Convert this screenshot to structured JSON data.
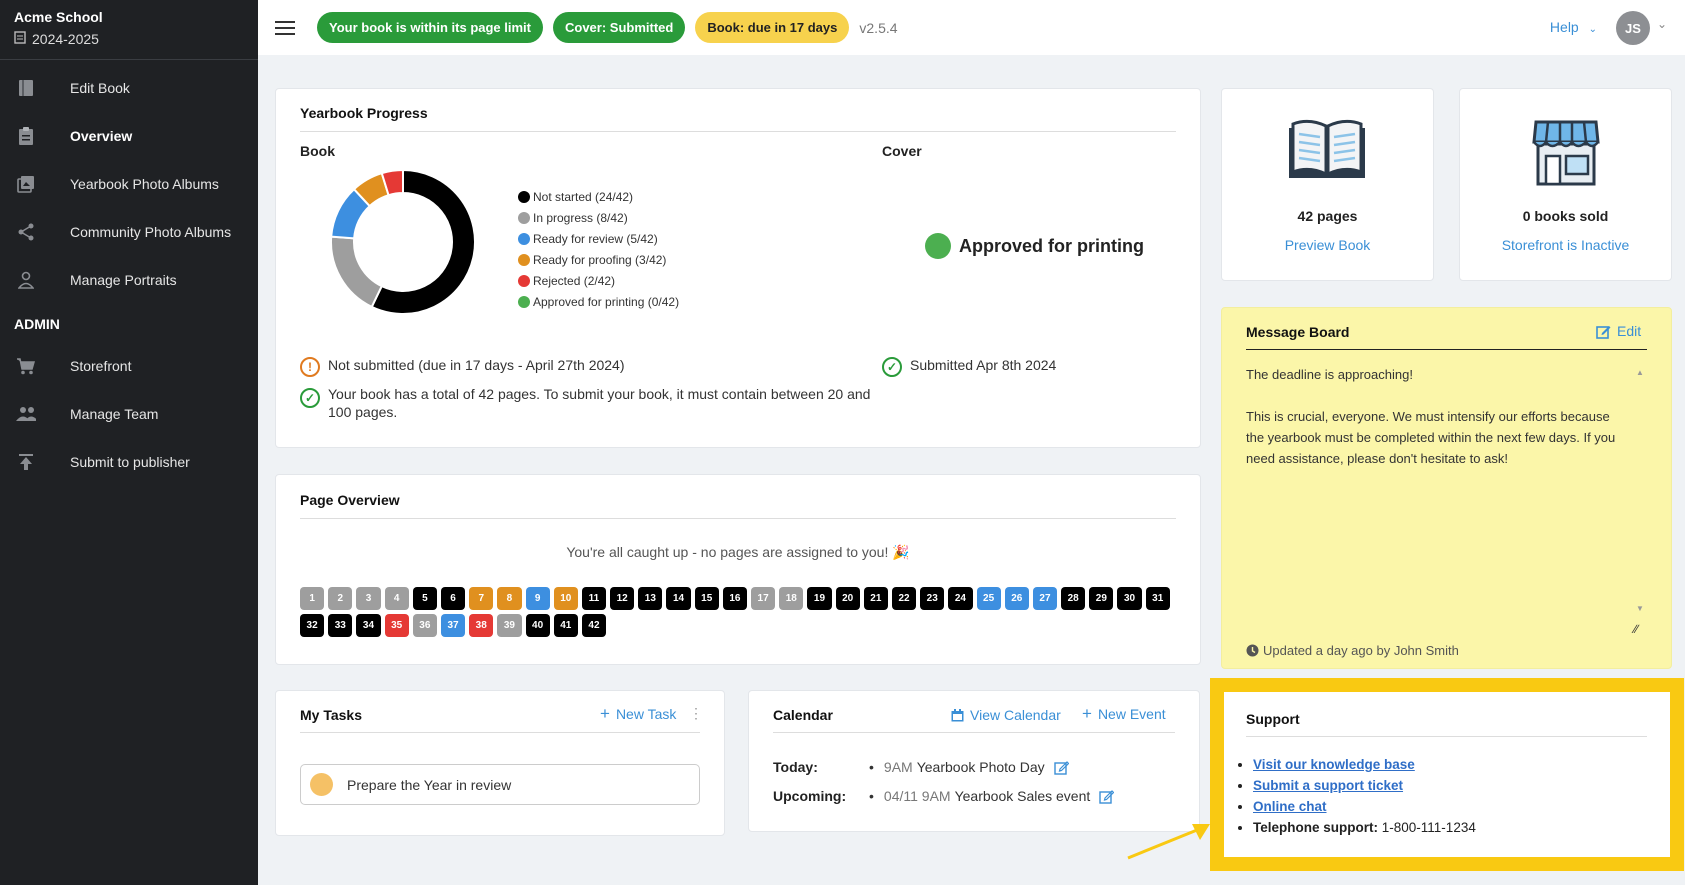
{
  "sidebar": {
    "school": "Acme School",
    "year": "2024-2025",
    "items": [
      {
        "label": "Edit Book"
      },
      {
        "label": "Overview"
      },
      {
        "label": "Yearbook Photo Albums"
      },
      {
        "label": "Community Photo Albums"
      },
      {
        "label": "Manage Portraits"
      }
    ],
    "admin_label": "ADMIN",
    "admin_items": [
      {
        "label": "Storefront"
      },
      {
        "label": "Manage Team"
      },
      {
        "label": "Submit to publisher"
      }
    ]
  },
  "topbar": {
    "badges": [
      {
        "label": "Your book is within its page limit",
        "color": "#2a9b3a"
      },
      {
        "label": "Cover: Submitted",
        "color": "#2a9b3a"
      },
      {
        "label": "Book: due in 17 days",
        "color": "#f7d24d"
      }
    ],
    "version": "v2.5.4",
    "help": "Help",
    "avatar": "JS"
  },
  "progress": {
    "title": "Yearbook Progress",
    "book_label": "Book",
    "cover_label": "Cover",
    "legend": [
      {
        "label": "Not started (24/42)",
        "color": "#000000",
        "value": 24
      },
      {
        "label": "In progress (8/42)",
        "color": "#9e9e9e",
        "value": 8
      },
      {
        "label": "Ready for review (5/42)",
        "color": "#3d8fe0",
        "value": 5
      },
      {
        "label": "Ready for proofing (3/42)",
        "color": "#e0901f",
        "value": 3
      },
      {
        "label": "Rejected (2/42)",
        "color": "#e53935",
        "value": 2
      },
      {
        "label": "Approved for printing (0/42)",
        "color": "#4caf50",
        "value": 0
      }
    ],
    "cover_status": "Approved for printing",
    "book_status": "Not submitted (due in 17 days - April 27th 2024)",
    "book_pages_note": "Your book has a total of 42 pages. To submit your book, it must contain between 20 and 100 pages.",
    "cover_submitted": "Submitted Apr 8th 2024"
  },
  "page_overview": {
    "title": "Page Overview",
    "message": "You're all caught up - no pages are assigned to you! 🎉",
    "pages": [
      {
        "n": "1",
        "c": "#9e9e9e"
      },
      {
        "n": "2",
        "c": "#9e9e9e"
      },
      {
        "n": "3",
        "c": "#9e9e9e"
      },
      {
        "n": "4",
        "c": "#9e9e9e"
      },
      {
        "n": "5",
        "c": "#000"
      },
      {
        "n": "6",
        "c": "#000"
      },
      {
        "n": "7",
        "c": "#e0901f"
      },
      {
        "n": "8",
        "c": "#e0901f"
      },
      {
        "n": "9",
        "c": "#3d8fe0"
      },
      {
        "n": "10",
        "c": "#e0901f"
      },
      {
        "n": "11",
        "c": "#000"
      },
      {
        "n": "12",
        "c": "#000"
      },
      {
        "n": "13",
        "c": "#000"
      },
      {
        "n": "14",
        "c": "#000"
      },
      {
        "n": "15",
        "c": "#000"
      },
      {
        "n": "16",
        "c": "#000"
      },
      {
        "n": "17",
        "c": "#9e9e9e"
      },
      {
        "n": "18",
        "c": "#9e9e9e"
      },
      {
        "n": "19",
        "c": "#000"
      },
      {
        "n": "20",
        "c": "#000"
      },
      {
        "n": "21",
        "c": "#000"
      },
      {
        "n": "22",
        "c": "#000"
      },
      {
        "n": "23",
        "c": "#000"
      },
      {
        "n": "24",
        "c": "#000"
      },
      {
        "n": "25",
        "c": "#3d8fe0"
      },
      {
        "n": "26",
        "c": "#3d8fe0"
      },
      {
        "n": "27",
        "c": "#3d8fe0"
      },
      {
        "n": "28",
        "c": "#000"
      },
      {
        "n": "29",
        "c": "#000"
      },
      {
        "n": "30",
        "c": "#000"
      },
      {
        "n": "31",
        "c": "#000"
      },
      {
        "n": "32",
        "c": "#000"
      },
      {
        "n": "33",
        "c": "#000"
      },
      {
        "n": "34",
        "c": "#000"
      },
      {
        "n": "35",
        "c": "#e53935"
      },
      {
        "n": "36",
        "c": "#9e9e9e"
      },
      {
        "n": "37",
        "c": "#3d8fe0"
      },
      {
        "n": "38",
        "c": "#e53935"
      },
      {
        "n": "39",
        "c": "#9e9e9e"
      },
      {
        "n": "40",
        "c": "#000"
      },
      {
        "n": "41",
        "c": "#000"
      },
      {
        "n": "42",
        "c": "#000"
      }
    ]
  },
  "book_card": {
    "pages": "42 pages",
    "link": "Preview Book"
  },
  "store_card": {
    "sold": "0 books sold",
    "link": "Storefront is Inactive"
  },
  "message_board": {
    "title": "Message Board",
    "edit": "Edit",
    "text": "The deadline is approaching!\n\nThis is crucial, everyone. We must intensify our efforts because the yearbook must be completed within the next few days. If you need assistance, please don't hesitate to ask!",
    "updated": "Updated a day ago by John Smith"
  },
  "tasks": {
    "title": "My Tasks",
    "new_task": "New Task",
    "items": [
      {
        "label": "Prepare the Year in review"
      }
    ]
  },
  "calendar": {
    "title": "Calendar",
    "view": "View Calendar",
    "new_event": "New Event",
    "today_label": "Today:",
    "today_event_time": "9AM",
    "today_event": "Yearbook Photo Day",
    "upcoming_label": "Upcoming:",
    "upcoming_event_time": "04/11 9AM",
    "upcoming_event": "Yearbook Sales event"
  },
  "support": {
    "title": "Support",
    "links": [
      "Visit our knowledge base",
      "Submit a support ticket",
      "Online chat"
    ],
    "phone_label": "Telephone support:",
    "phone": "1-800-111-1234"
  }
}
